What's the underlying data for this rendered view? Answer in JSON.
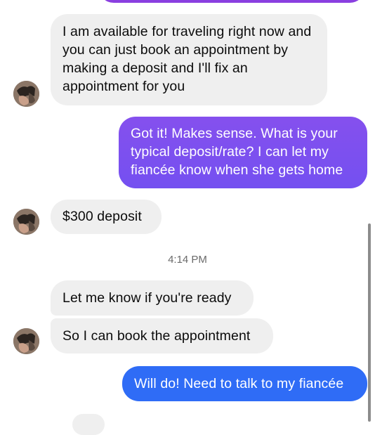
{
  "messages": {
    "m1": "I am available for traveling right now and you can just book an appointment by making a deposit and I'll fix an appointment for you",
    "m2": "Got it! Makes sense. What is your typical deposit/rate? I can let my fiancée know when she gets home",
    "m3": "$300 deposit",
    "m4": "Let me know if you're ready",
    "m5": "So I can book the appointment",
    "m6": "Will do! Need to talk to my fiancée"
  },
  "timestamp": "4:14 PM",
  "colors": {
    "incoming_bubble": "#efefef",
    "outgoing_purple": "#7b4ff0",
    "outgoing_blue": "#2f6cf6",
    "top_bubble": "#8a3fe0"
  },
  "icons": {
    "avatar": "contact-avatar-icon"
  }
}
